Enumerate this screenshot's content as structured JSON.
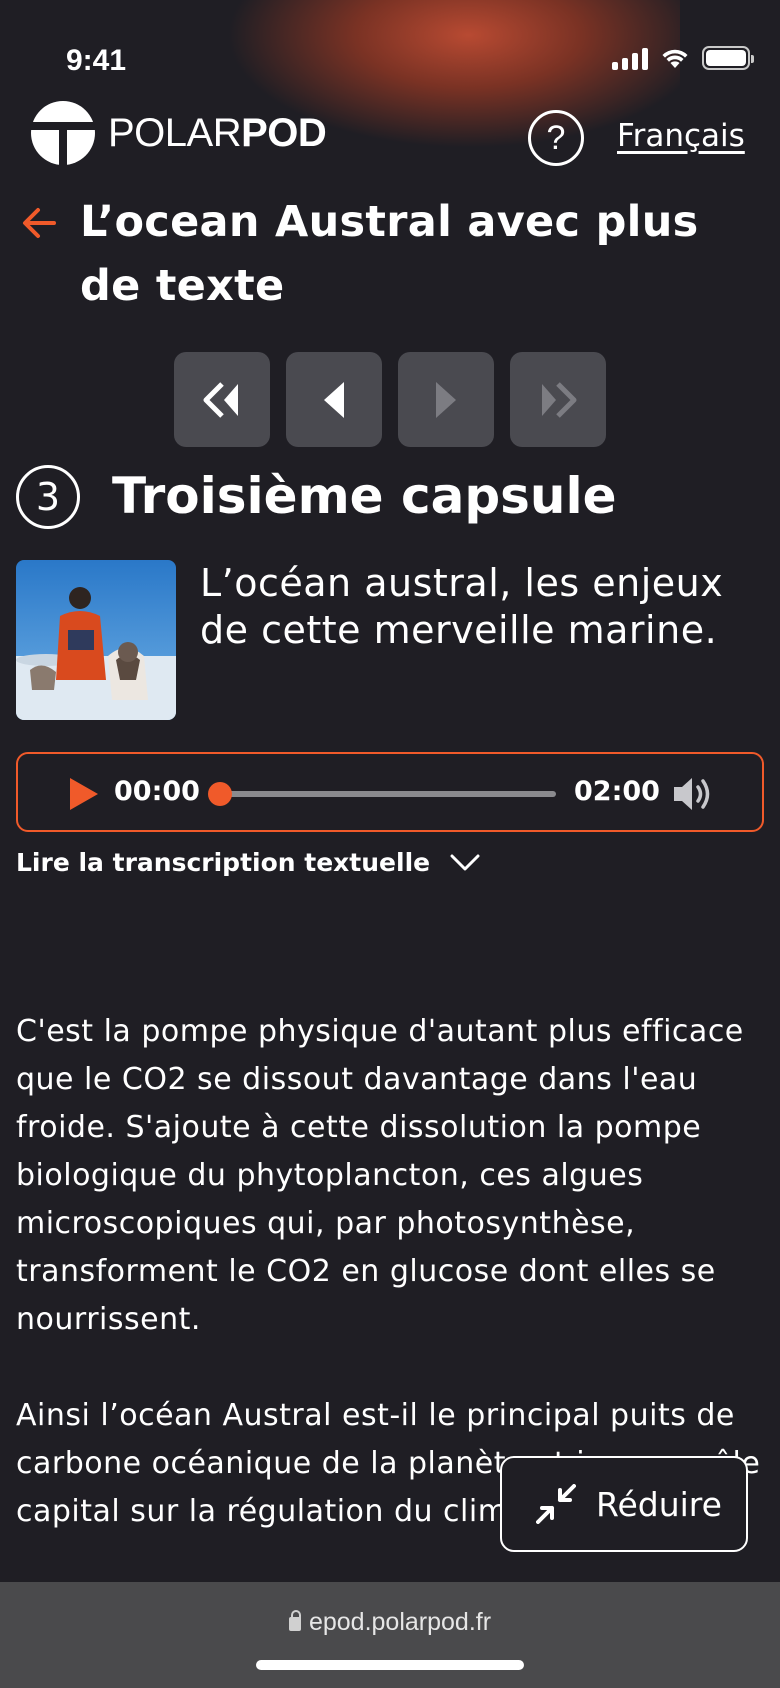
{
  "status": {
    "time": "9:41"
  },
  "header": {
    "logo_text_thin": "POLAR",
    "logo_text_bold": "POD",
    "help_label": "?",
    "language": "Français"
  },
  "page": {
    "title": "L’ocean Austral avec plus de texte"
  },
  "capsule": {
    "number": "3",
    "title": "Troisième capsule",
    "description": "L’océan austral, les enjeux de cette merveille marine."
  },
  "player": {
    "current_time": "00:00",
    "duration": "02:00",
    "progress": 0
  },
  "transcript": {
    "toggle_label": "Lire la transcription textuelle",
    "paragraphs": [
      "C'est la pompe physique d'autant plus efficace que le CO2 se dissout davantage dans l'eau froide. S'ajoute à cette dissolution la pompe biologique du phytoplancton, ces algues microscopiques qui, par photosynthèse, transforment le CO2 en glucose dont elles se nourrissent.",
      "Ainsi l’océan Austral est-il le principal puits de carbone océanique de la planète et joue un rôle capital sur la régulation du climat de la Terre."
    ]
  },
  "reduce_button": {
    "label": "Réduire"
  },
  "browser": {
    "url": "epod.polarpod.fr"
  },
  "colors": {
    "accent": "#f05a2a",
    "background": "#1f1e24",
    "nav_button": "#4a4a50"
  }
}
